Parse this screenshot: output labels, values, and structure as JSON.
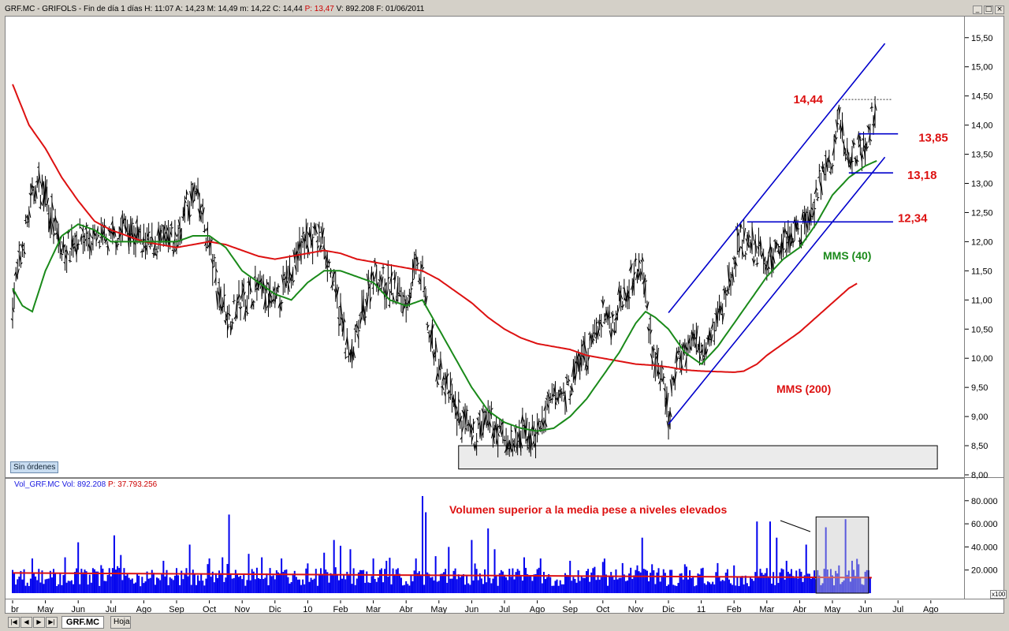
{
  "title": {
    "prefix": "GRF.MC - GRIFOLS - Fin de día 1 días  H: 11:07  A: 14,23  M: 14,49  m: 14,22  C: 14,44",
    "p_value": "P: 13,47",
    "suffix": "V: 892.208  F: 01/06/2011"
  },
  "window_buttons": [
    "_",
    "□",
    "×"
  ],
  "sin_ordenes": "Sin órdenes",
  "volume_header": {
    "label": "Vol_GRF.MC  Vol: 892.208",
    "p_value": "P: 37.793.256"
  },
  "x100_label": "x100",
  "tabs": {
    "active": "GRF.MC",
    "sheet": "Hoja"
  },
  "nav_buttons": [
    "|◀",
    "◀",
    "▶",
    "▶|"
  ],
  "colors": {
    "price_bars": "#000000",
    "mms40": "#1a8a1a",
    "mms200": "#dd1111",
    "trend_lines": "#0000cc",
    "annotations": "#dd1111",
    "volume_bars": "#0000ee",
    "volume_avg": "#dd1111"
  },
  "chart_data": [
    {
      "type": "line",
      "title": "GRF.MC - GRIFOLS",
      "y_ticks": [
        "15,50",
        "15,00",
        "14,50",
        "14,00",
        "13,50",
        "13,00",
        "12,50",
        "12,00",
        "11,50",
        "11,00",
        "10,50",
        "10,00",
        "9,50",
        "9,00",
        "8,50",
        "8,00"
      ],
      "ylim": [
        8.0,
        15.7
      ],
      "x_labels": [
        "Abr",
        "May",
        "Jun",
        "Jul",
        "Ago",
        "Sep",
        "Oct",
        "Nov",
        "Dic",
        "10",
        "Feb",
        "Mar",
        "Abr",
        "May",
        "Jun",
        "Jul",
        "Ago",
        "Sep",
        "Oct",
        "Nov",
        "Dic",
        "11",
        "Feb",
        "Mar",
        "Abr",
        "May",
        "Jun",
        "Jul",
        "Ago"
      ],
      "x_label_display": [
        "br",
        "May",
        "Jun",
        "Jul",
        "Ago",
        "Sep",
        "Oct",
        "Nov",
        "Dic",
        "10",
        "Feb",
        "Mar",
        "Abr",
        "May",
        "Jun",
        "Jul",
        "Ago",
        "Sep",
        "Oct",
        "Nov",
        "Dic",
        "11",
        "Feb",
        "Mar",
        "Abr",
        "May",
        "Jun",
        "Jul",
        "Ago"
      ],
      "price_anchors": [
        [
          0,
          11.0
        ],
        [
          0.5,
          12.5
        ],
        [
          0.7,
          13.0
        ],
        [
          1.0,
          12.8
        ],
        [
          1.3,
          12.2
        ],
        [
          1.5,
          11.8
        ],
        [
          2.0,
          12.1
        ],
        [
          2.5,
          12.0
        ],
        [
          3.0,
          12.0
        ],
        [
          3.5,
          12.3
        ],
        [
          4.0,
          11.9
        ],
        [
          4.5,
          12.0
        ],
        [
          5.0,
          12.0
        ],
        [
          5.3,
          12.6
        ],
        [
          5.6,
          12.8
        ],
        [
          6.0,
          11.9
        ],
        [
          6.3,
          11.1
        ],
        [
          6.6,
          10.7
        ],
        [
          7.0,
          11.0
        ],
        [
          7.5,
          11.2
        ],
        [
          8.0,
          10.9
        ],
        [
          8.3,
          11.2
        ],
        [
          8.6,
          11.7
        ],
        [
          9.0,
          12.1
        ],
        [
          9.5,
          12.0
        ],
        [
          9.8,
          11.2
        ],
        [
          10.0,
          10.7
        ],
        [
          10.3,
          9.9
        ],
        [
          10.6,
          10.6
        ],
        [
          11.0,
          11.5
        ],
        [
          11.5,
          11.2
        ],
        [
          12.0,
          11.0
        ],
        [
          12.3,
          11.5
        ],
        [
          12.5,
          11.4
        ],
        [
          12.7,
          10.4
        ],
        [
          13.0,
          9.8
        ],
        [
          13.3,
          9.4
        ],
        [
          13.6,
          9.0
        ],
        [
          14.0,
          8.6
        ],
        [
          14.3,
          8.8
        ],
        [
          14.6,
          8.9
        ],
        [
          15.0,
          8.6
        ],
        [
          15.3,
          8.5
        ],
        [
          15.6,
          8.7
        ],
        [
          16.0,
          8.7
        ],
        [
          16.5,
          9.3
        ],
        [
          16.8,
          9.4
        ],
        [
          17.0,
          9.5
        ],
        [
          17.3,
          10.0
        ],
        [
          17.6,
          10.1
        ],
        [
          18.0,
          10.8
        ],
        [
          18.3,
          10.6
        ],
        [
          18.6,
          11.1
        ],
        [
          19.0,
          11.5
        ],
        [
          19.2,
          11.5
        ],
        [
          19.5,
          10.2
        ],
        [
          19.8,
          9.6
        ],
        [
          20.0,
          8.9
        ],
        [
          20.2,
          9.8
        ],
        [
          20.5,
          10.2
        ],
        [
          20.8,
          10.3
        ],
        [
          21.0,
          10.2
        ],
        [
          21.3,
          10.5
        ],
        [
          21.6,
          10.8
        ],
        [
          21.8,
          11.2
        ],
        [
          22.0,
          11.6
        ],
        [
          22.2,
          12.1
        ],
        [
          22.4,
          11.9
        ],
        [
          22.8,
          11.8
        ],
        [
          23.0,
          11.6
        ],
        [
          23.3,
          11.9
        ],
        [
          23.6,
          12.1
        ],
        [
          24.0,
          12.2
        ],
        [
          24.4,
          12.6
        ],
        [
          24.7,
          13.2
        ],
        [
          25.0,
          13.3
        ],
        [
          25.2,
          14.2
        ],
        [
          25.4,
          13.5
        ],
        [
          25.8,
          13.6
        ],
        [
          26.0,
          13.5
        ],
        [
          26.2,
          14.1
        ],
        [
          26.35,
          14.44
        ]
      ],
      "mms40_anchors": [
        [
          0,
          11.2
        ],
        [
          0.3,
          10.9
        ],
        [
          0.6,
          10.8
        ],
        [
          1.0,
          11.5
        ],
        [
          1.5,
          12.1
        ],
        [
          2.0,
          12.3
        ],
        [
          2.5,
          12.2
        ],
        [
          3.0,
          12.0
        ],
        [
          3.5,
          12.0
        ],
        [
          4.0,
          12.0
        ],
        [
          4.5,
          12.0
        ],
        [
          5.0,
          12.0
        ],
        [
          5.5,
          12.1
        ],
        [
          6.0,
          12.1
        ],
        [
          6.5,
          11.9
        ],
        [
          7.0,
          11.5
        ],
        [
          7.5,
          11.3
        ],
        [
          8.0,
          11.1
        ],
        [
          8.5,
          11.0
        ],
        [
          9.0,
          11.3
        ],
        [
          9.5,
          11.5
        ],
        [
          10.0,
          11.5
        ],
        [
          10.5,
          11.4
        ],
        [
          11.0,
          11.3
        ],
        [
          11.5,
          11.0
        ],
        [
          12.0,
          10.9
        ],
        [
          12.5,
          11.0
        ],
        [
          13.0,
          10.5
        ],
        [
          13.5,
          10.0
        ],
        [
          14.0,
          9.5
        ],
        [
          14.5,
          9.1
        ],
        [
          15.0,
          8.9
        ],
        [
          15.5,
          8.8
        ],
        [
          16.0,
          8.75
        ],
        [
          16.5,
          8.8
        ],
        [
          17.0,
          9.0
        ],
        [
          17.5,
          9.3
        ],
        [
          18.0,
          9.7
        ],
        [
          18.5,
          10.1
        ],
        [
          19.0,
          10.6
        ],
        [
          19.3,
          10.8
        ],
        [
          19.6,
          10.7
        ],
        [
          20.0,
          10.5
        ],
        [
          20.5,
          10.1
        ],
        [
          21.0,
          9.9
        ],
        [
          21.5,
          10.2
        ],
        [
          22.0,
          10.6
        ],
        [
          22.5,
          11.0
        ],
        [
          23.0,
          11.4
        ],
        [
          23.5,
          11.7
        ],
        [
          24.0,
          11.9
        ],
        [
          24.5,
          12.3
        ],
        [
          25.0,
          12.8
        ],
        [
          25.5,
          13.1
        ],
        [
          26.0,
          13.3
        ],
        [
          26.4,
          13.4
        ]
      ],
      "mms200_anchors": [
        [
          0,
          14.7
        ],
        [
          0.5,
          14.0
        ],
        [
          1.0,
          13.6
        ],
        [
          1.5,
          13.1
        ],
        [
          2.0,
          12.7
        ],
        [
          2.5,
          12.35
        ],
        [
          3.0,
          12.2
        ],
        [
          3.5,
          12.1
        ],
        [
          4.0,
          12.0
        ],
        [
          4.5,
          11.95
        ],
        [
          5.0,
          11.9
        ],
        [
          5.5,
          11.95
        ],
        [
          6.0,
          12.0
        ],
        [
          6.5,
          11.95
        ],
        [
          7.0,
          11.85
        ],
        [
          7.5,
          11.75
        ],
        [
          8.0,
          11.7
        ],
        [
          8.5,
          11.75
        ],
        [
          9.0,
          11.8
        ],
        [
          9.5,
          11.85
        ],
        [
          10.0,
          11.8
        ],
        [
          10.5,
          11.7
        ],
        [
          11.0,
          11.65
        ],
        [
          11.5,
          11.6
        ],
        [
          12.0,
          11.55
        ],
        [
          12.5,
          11.5
        ],
        [
          13.0,
          11.35
        ],
        [
          13.5,
          11.15
        ],
        [
          14.0,
          10.95
        ],
        [
          14.5,
          10.7
        ],
        [
          15.0,
          10.5
        ],
        [
          15.5,
          10.35
        ],
        [
          16.0,
          10.25
        ],
        [
          16.5,
          10.2
        ],
        [
          17.0,
          10.15
        ],
        [
          17.5,
          10.05
        ],
        [
          18.0,
          10.0
        ],
        [
          18.5,
          9.95
        ],
        [
          19.0,
          9.9
        ],
        [
          19.5,
          9.88
        ],
        [
          20.0,
          9.85
        ],
        [
          20.5,
          9.8
        ],
        [
          21.0,
          9.78
        ],
        [
          21.5,
          9.77
        ],
        [
          22.0,
          9.76
        ],
        [
          22.3,
          9.78
        ],
        [
          22.7,
          9.9
        ],
        [
          23.0,
          10.05
        ],
        [
          23.5,
          10.25
        ],
        [
          24.0,
          10.45
        ],
        [
          24.5,
          10.7
        ],
        [
          25.0,
          10.95
        ],
        [
          25.5,
          11.2
        ],
        [
          25.8,
          11.3
        ]
      ],
      "trend_lines": [
        {
          "from": [
            20.0,
            8.87
          ],
          "to": [
            26.6,
            13.45
          ]
        },
        {
          "from": [
            20.0,
            10.78
          ],
          "to": [
            26.6,
            15.4
          ]
        }
      ],
      "support_lines": [
        {
          "value": 12.34,
          "label": "12,34",
          "x_from": 22.4,
          "x_to": 26.85
        },
        {
          "value": 13.18,
          "label": "13,18",
          "x_from": 25.5,
          "x_to": 26.85
        },
        {
          "value": 13.85,
          "label": "13,85",
          "x_from": 25.8,
          "x_to": 27.0
        }
      ],
      "dashed_level": {
        "value": 14.44,
        "label": "14,44",
        "x_from": 25.3,
        "x_to": 26.8
      },
      "support_zone": {
        "y_from": 8.1,
        "y_to": 8.5,
        "x_from": 13.6,
        "x_to": 28.2
      },
      "series_labels": {
        "mms40": "MMS (40)",
        "mms200": "MMS (200)"
      }
    },
    {
      "type": "bar",
      "title": "Vol_GRF.MC",
      "y_ticks": [
        "80.000",
        "60.000",
        "40.000",
        "20.000"
      ],
      "ylim": [
        0,
        88000
      ],
      "avg_level": 17500,
      "volume_spikes": [
        [
          0.6,
          30000
        ],
        [
          1.6,
          31000
        ],
        [
          2.0,
          44000
        ],
        [
          3.1,
          50000
        ],
        [
          3.3,
          33000
        ],
        [
          4.6,
          28000
        ],
        [
          5.4,
          42000
        ],
        [
          6.0,
          30000
        ],
        [
          6.4,
          31000
        ],
        [
          6.6,
          68000
        ],
        [
          7.2,
          34000
        ],
        [
          7.6,
          31000
        ],
        [
          8.2,
          30000
        ],
        [
          9.5,
          35000
        ],
        [
          9.8,
          46000
        ],
        [
          10.0,
          41000
        ],
        [
          10.3,
          38000
        ],
        [
          11.0,
          30000
        ],
        [
          11.4,
          28000
        ],
        [
          12.3,
          30000
        ],
        [
          12.5,
          84000
        ],
        [
          12.6,
          70000
        ],
        [
          12.9,
          32000
        ],
        [
          13.3,
          40000
        ],
        [
          14.0,
          46000
        ],
        [
          14.5,
          56000
        ],
        [
          14.7,
          38000
        ],
        [
          15.6,
          31000
        ],
        [
          16.1,
          30000
        ],
        [
          17.0,
          28000
        ],
        [
          18.0,
          27000
        ],
        [
          18.6,
          26000
        ],
        [
          19.2,
          48000
        ],
        [
          19.5,
          25000
        ],
        [
          20.5,
          25000
        ],
        [
          21.5,
          26000
        ],
        [
          22.0,
          24000
        ],
        [
          22.7,
          62000
        ],
        [
          23.1,
          62000
        ],
        [
          23.3,
          48000
        ],
        [
          23.6,
          28000
        ],
        [
          24.2,
          42000
        ],
        [
          24.8,
          57000
        ],
        [
          25.2,
          24000
        ],
        [
          25.4,
          64000
        ],
        [
          25.6,
          28000
        ],
        [
          25.8,
          25000
        ]
      ],
      "annotation": "Volumen superior a la media pese a niveles elevados",
      "highlight_box": {
        "x_from": 24.5,
        "x_to": 26.1,
        "y_to": 66000
      }
    }
  ]
}
